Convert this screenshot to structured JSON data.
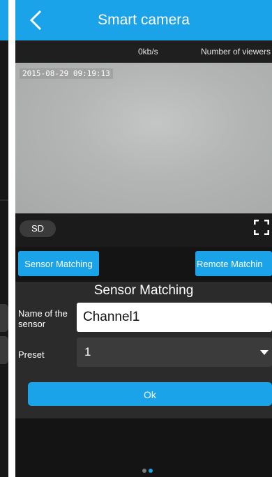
{
  "titlebar": {
    "title": "Smart camera",
    "back_icon": "chevron-left-icon"
  },
  "status": {
    "speed": "0kb/s",
    "viewers_label": "Number of viewers"
  },
  "video": {
    "timestamp": "2015-08-29 09:19:13"
  },
  "controls": {
    "quality_label": "SD",
    "fullscreen_icon": "fullscreen-icon"
  },
  "mode_buttons": {
    "sensor_matching": "Sensor Matching",
    "remote_matching": "Remote Matchin"
  },
  "panel": {
    "title": "Sensor Matching",
    "name_label": "Name of the sensor",
    "name_value": "Channel1",
    "preset_label": "Preset",
    "preset_value": "1",
    "ok_label": "Ok"
  },
  "pager": {
    "page_count": 2,
    "active_page": 2
  },
  "colors": {
    "accent": "#1aa3e8",
    "background": "#141414",
    "panel": "#2b2b2b",
    "select": "#3b3b3b"
  }
}
